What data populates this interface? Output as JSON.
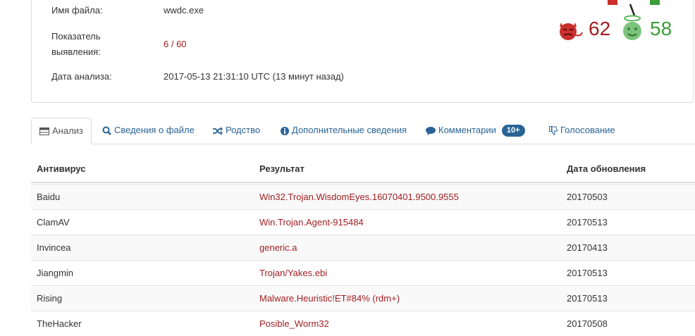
{
  "summary": {
    "file_name_label": "Имя файла:",
    "file_name": "wwdc.exe",
    "detection_label": "Показатель выявления:",
    "detection_line1": "Показатель",
    "detection_line2": "выявления:",
    "detection_ratio": "6 / 60",
    "date_label": "Дата анализа:",
    "date_value": "2017-05-13 21:31:10 UTC (13 минут назад)",
    "score_bad": "62",
    "score_good": "58"
  },
  "tabs": [
    {
      "label": "Анализ",
      "icon": "table-icon"
    },
    {
      "label": "Сведения о файле",
      "icon": "search-icon"
    },
    {
      "label": "Родство",
      "icon": "shuffle-icon"
    },
    {
      "label": "Дополнительные сведения",
      "icon": "info-icon"
    },
    {
      "label": "Комментарии",
      "icon": "comment-icon",
      "badge": "10+"
    },
    {
      "label": "Голосование",
      "icon": "thumbs-down-icon"
    }
  ],
  "table": {
    "headers": [
      "Антивирус",
      "Результат",
      "Дата обновления"
    ],
    "rows": [
      {
        "av": "Baidu",
        "result": "Win32.Trojan.WisdomEyes.16070401.9500.9555",
        "date": "20170503"
      },
      {
        "av": "ClamAV",
        "result": "Win.Trojan.Agent-915484",
        "date": "20170513"
      },
      {
        "av": "Invincea",
        "result": "generic.a",
        "date": "20170413"
      },
      {
        "av": "Jiangmin",
        "result": "Trojan/Yakes.ebi",
        "date": "20170513"
      },
      {
        "av": "Rising",
        "result": "Malware.Heuristic!ET#84% (rdm+)",
        "date": "20170513"
      },
      {
        "av": "TheHacker",
        "result": "Posible_Worm32",
        "date": "20170508"
      }
    ]
  },
  "colors": {
    "link": "#2a6496",
    "malicious": "#a11e21",
    "good": "#3c9d39",
    "border": "#dddddd"
  }
}
